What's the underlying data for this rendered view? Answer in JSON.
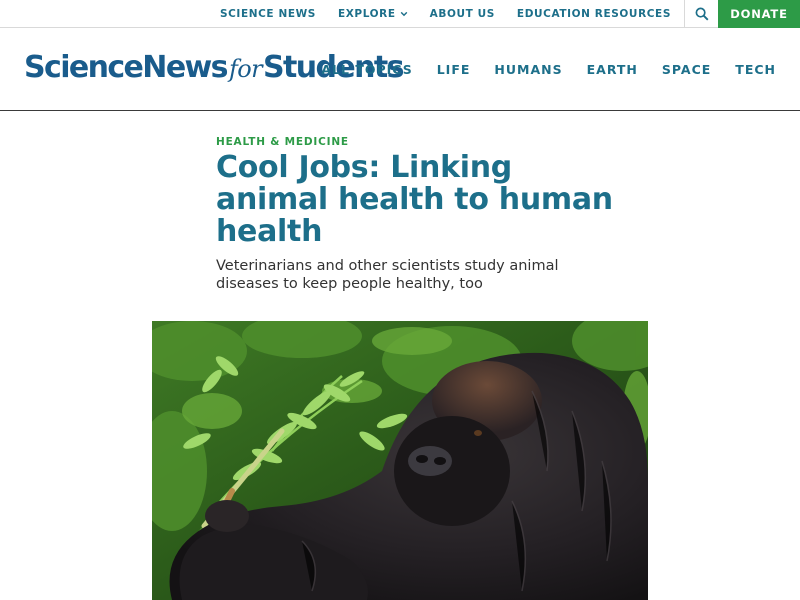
{
  "utility_nav": {
    "items": [
      {
        "label": "SCIENCE NEWS"
      },
      {
        "label": "EXPLORE",
        "icon": "chevron-down-icon"
      },
      {
        "label": "ABOUT US"
      },
      {
        "label": "EDUCATION RESOURCES"
      }
    ],
    "search_icon": "search-icon",
    "donate_label": "DONATE"
  },
  "logo": {
    "part1": "ScienceNews",
    "part2": "for",
    "part3": "Students"
  },
  "main_nav": {
    "items": [
      {
        "label": "ALL TOPICS"
      },
      {
        "label": "LIFE"
      },
      {
        "label": "HUMANS"
      },
      {
        "label": "EARTH"
      },
      {
        "label": "SPACE"
      },
      {
        "label": "TECH"
      }
    ]
  },
  "article": {
    "category": "HEALTH & MEDICINE",
    "title": "Cool Jobs: Linking animal health to human health",
    "dek": "Veterinarians and other scientists study animal diseases to keep people healthy, too",
    "hero_image": "gorilla-photo"
  },
  "colors": {
    "brand_blue": "#1d6f8a",
    "logo_blue": "#1a5c8c",
    "accent_green": "#2d9b47"
  }
}
